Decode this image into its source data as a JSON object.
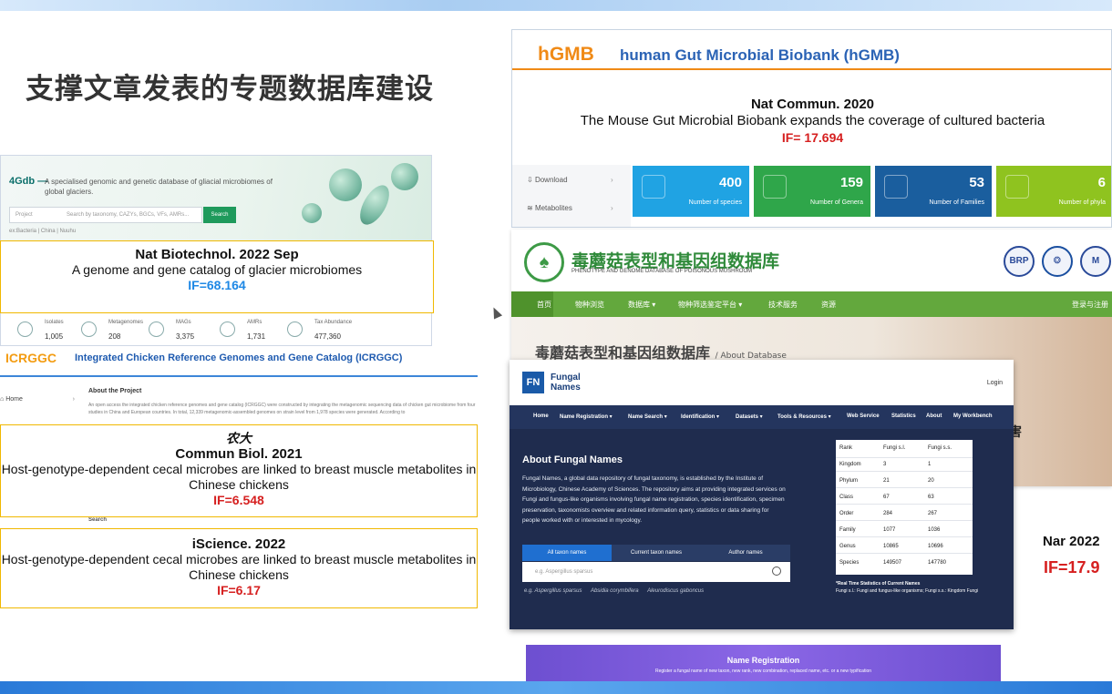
{
  "slide": {
    "title": "支撑文章发表的专题数据库建设",
    "accent_color": "#2a7ad8"
  },
  "g4db": {
    "logo": "4Gdb —",
    "tagline": "A specialised genomic and genetic database of gliacial microbiomes of global glaciers.",
    "search": {
      "select": "Project",
      "placeholder": "Search by taxonomy, CAZYs, BGCs, VFs, AMRs...",
      "button": "Search"
    },
    "hint": "ex:Bacteria | China | Nuuhu",
    "stats": [
      {
        "label": "Isolates",
        "value": "1,005",
        "icon": "isolate-icon"
      },
      {
        "label": "Metagenomes",
        "value": "208",
        "icon": "metagenome-icon"
      },
      {
        "label": "MAGs",
        "value": "3,375",
        "icon": "mag-icon"
      },
      {
        "label": "AMRs",
        "value": "1,731",
        "icon": "amr-icon"
      },
      {
        "label": "Tax Abundance",
        "value": "477,360",
        "icon": "abundance-icon"
      }
    ],
    "citation": {
      "journal": "Nat Biotechnol. 2022 Sep",
      "title": "A genome and gene catalog of glacier microbiomes",
      "impact": "IF=68.164"
    }
  },
  "icrggc": {
    "logo": "ICRGGC",
    "title": "Integrated Chicken Reference Genomes and Gene Catalog (ICRGGC)",
    "nav_home": "Home",
    "about_heading": "About the Project",
    "about_text": "An open access the integrated chicken reference genomes and gene catalog (ICRGGC) were constructed by integrating the metagenomic sequencing data of chicken gut microbiome from four studies in China and European countries. In total, 12,339 metagenomic-assembled genomes on strain level from 1,978 species were generated. According to",
    "search_label": "Search",
    "citations": [
      {
        "note": "农大",
        "journal": "Commun Biol. 2021",
        "title": "Host-genotype-dependent cecal microbes are linked to breast muscle metabolites in Chinese chickens",
        "impact": "IF=6.548"
      },
      {
        "journal": "iScience. 2022",
        "title": "Host-genotype-dependent cecal microbes are linked to breast muscle metabolites in Chinese chickens",
        "impact": "IF=6.17"
      }
    ]
  },
  "hgmb": {
    "logo": "hGMB",
    "title": "human Gut Microbial Biobank (hGMB)",
    "citation": {
      "journal": "Nat Commun. 2020",
      "title": "The Mouse Gut Microbial Biobank expands the coverage of cultured bacteria",
      "impact": "IF= 17.694"
    },
    "sidebar": [
      {
        "label": "Download",
        "icon": "download-icon"
      },
      {
        "label": "Metabolites",
        "icon": "metabolites-icon"
      }
    ],
    "cards": [
      {
        "value": "400",
        "label": "Number of species",
        "color": "#20a3e3"
      },
      {
        "value": "159",
        "label": "Number of Genera",
        "color": "#2fa64a"
      },
      {
        "value": "53",
        "label": "Number of Families",
        "color": "#1a5e9e"
      },
      {
        "value": "6",
        "label": "Number of phyla",
        "color": "#8fc31f"
      }
    ]
  },
  "mushroom": {
    "title": "毒蘑菇表型和基因组数据库",
    "subtitle": "PHENOTYPE AND GENOME DATABASE OF POISONOUS MUSHROOM",
    "badges": [
      "BRP",
      "",
      "M"
    ],
    "nav": [
      "首页",
      "物种浏览",
      "数据库 ▾",
      "物种筛选鉴定平台 ▾",
      "技术服务",
      "资源",
      "登录与注册"
    ],
    "heading": "毒蘑菇表型和基因组数据库",
    "crumb": "/ About Database",
    "fragment": "害"
  },
  "fungal_names": {
    "logo": "FN",
    "name_line1": "Fungal",
    "name_line2": "Names",
    "login": "Login",
    "nav": [
      "Home",
      "Name Registration ▾",
      "Name Search ▾",
      "Identification ▾",
      "Datasets ▾",
      "Tools & Resources ▾",
      "Web Service",
      "Statistics",
      "About",
      "My Workbench"
    ],
    "about_heading": "About Fungal Names",
    "about_text": "Fungal Names, a global data repository of fungal taxonomy, is established by the Institute of Microbiology, Chinese Academy of Sciences. The repository aims at providing integrated services on Fungi and fungus-like organisms involving fungal name registration, species identification, specimen preservation, taxonomists overview and related information query, statistics or data sharing for people worked with or interested in mycology.",
    "tabs": [
      "All taxon names",
      "Current taxon names",
      "Author names"
    ],
    "search_placeholder": "e.g. Aspergillus sparsus",
    "examples": [
      "e.g. Aspergillus sparsus",
      "Absidia corymbifera",
      "Aleurodiscus gaboncus"
    ],
    "table": {
      "headers": [
        "Rank",
        "Fungi s.l.",
        "Fungi s.s."
      ],
      "rows": [
        [
          "Kingdom",
          "3",
          "1"
        ],
        [
          "Phylum",
          "21",
          "20"
        ],
        [
          "Class",
          "67",
          "63"
        ],
        [
          "Order",
          "284",
          "267"
        ],
        [
          "Family",
          "1077",
          "1036"
        ],
        [
          "Genus",
          "10865",
          "10696"
        ],
        [
          "Species",
          "149507",
          "147780"
        ]
      ]
    },
    "note_title": "*Real Time Statistics of Current Names",
    "note_text": "Fungi s.l.: Fungi and fungus-like organisms; Fungi s.s.: Kingdom Fungi",
    "name_registration": {
      "title": "Name Registration",
      "subtitle": "Register a fungal name of new taxon, new rank, new combination, replaced name, etc. or a new typification"
    }
  },
  "nar": {
    "journal": "Nar 2022",
    "impact": "IF=17.9"
  }
}
